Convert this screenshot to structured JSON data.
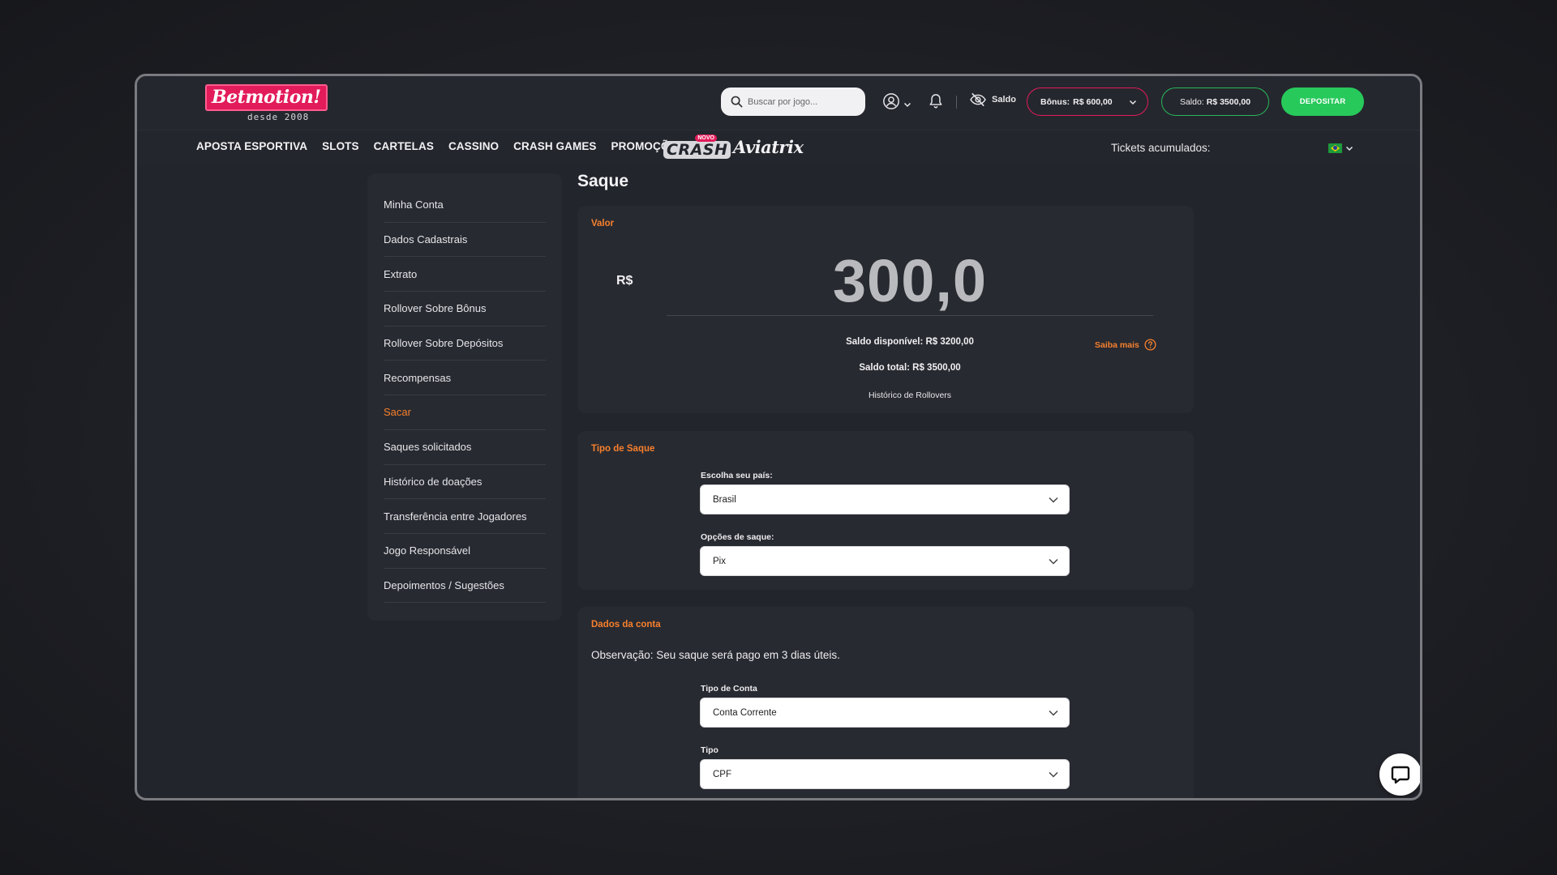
{
  "header": {
    "logo_text": "Betmotion!",
    "logo_since": "desde 2008",
    "search_placeholder": "Buscar por jogo...",
    "saldo_toggle_label": "Saldo",
    "bonus_label": "Bônus:",
    "bonus_value": "R$ 600,00",
    "saldo_label": "Saldo:",
    "saldo_value": "R$ 3500,00",
    "deposit_label": "DEPOSITAR"
  },
  "nav": {
    "items": [
      "APOSTA ESPORTIVA",
      "SLOTS",
      "CARTELAS",
      "CASSINO",
      "CRASH GAMES",
      "PROMOÇÕES"
    ],
    "crash_logo_text": "CRASH",
    "crash_logo_badge": "NOVO",
    "aviatrix_text": "Aviatrix",
    "tickets_label": "Tickets acumulados:"
  },
  "sidebar": {
    "items": [
      {
        "label": "Minha Conta"
      },
      {
        "label": "Dados Cadastrais"
      },
      {
        "label": "Extrato"
      },
      {
        "label": "Rollover Sobre Bônus"
      },
      {
        "label": "Rollover Sobre Depósitos"
      },
      {
        "label": "Recompensas"
      },
      {
        "label": "Sacar",
        "active": true
      },
      {
        "label": "Saques solicitados"
      },
      {
        "label": "Histórico de doações"
      },
      {
        "label": "Transferência entre Jogadores"
      },
      {
        "label": "Jogo Responsável"
      },
      {
        "label": "Depoimentos / Sugestões"
      }
    ]
  },
  "main": {
    "title": "Saque",
    "valor": {
      "label": "Valor",
      "currency": "R$",
      "amount": "300,0",
      "saldo_disponivel": "Saldo disponível: R$ 3200,00",
      "saiba_mais": "Saiba mais",
      "saldo_total": "Saldo total: R$ 3500,00",
      "historico": "Histórico de Rollovers"
    },
    "tipo_saque": {
      "label": "Tipo de Saque",
      "pais_label": "Escolha seu país:",
      "pais_value": "Brasil",
      "opcoes_label": "Opções de saque:",
      "opcoes_value": "Pix"
    },
    "dados_conta": {
      "label": "Dados da conta",
      "observacao": "Observação: Seu saque será pago em 3 dias úteis.",
      "tipo_conta_label": "Tipo de Conta",
      "tipo_conta_value": "Conta Corrente",
      "tipo_label": "Tipo",
      "tipo_value": "CPF"
    }
  },
  "colors": {
    "accent_orange": "#f6802d",
    "brand_pink": "#e21b5a",
    "deposit_green": "#27c95b"
  }
}
